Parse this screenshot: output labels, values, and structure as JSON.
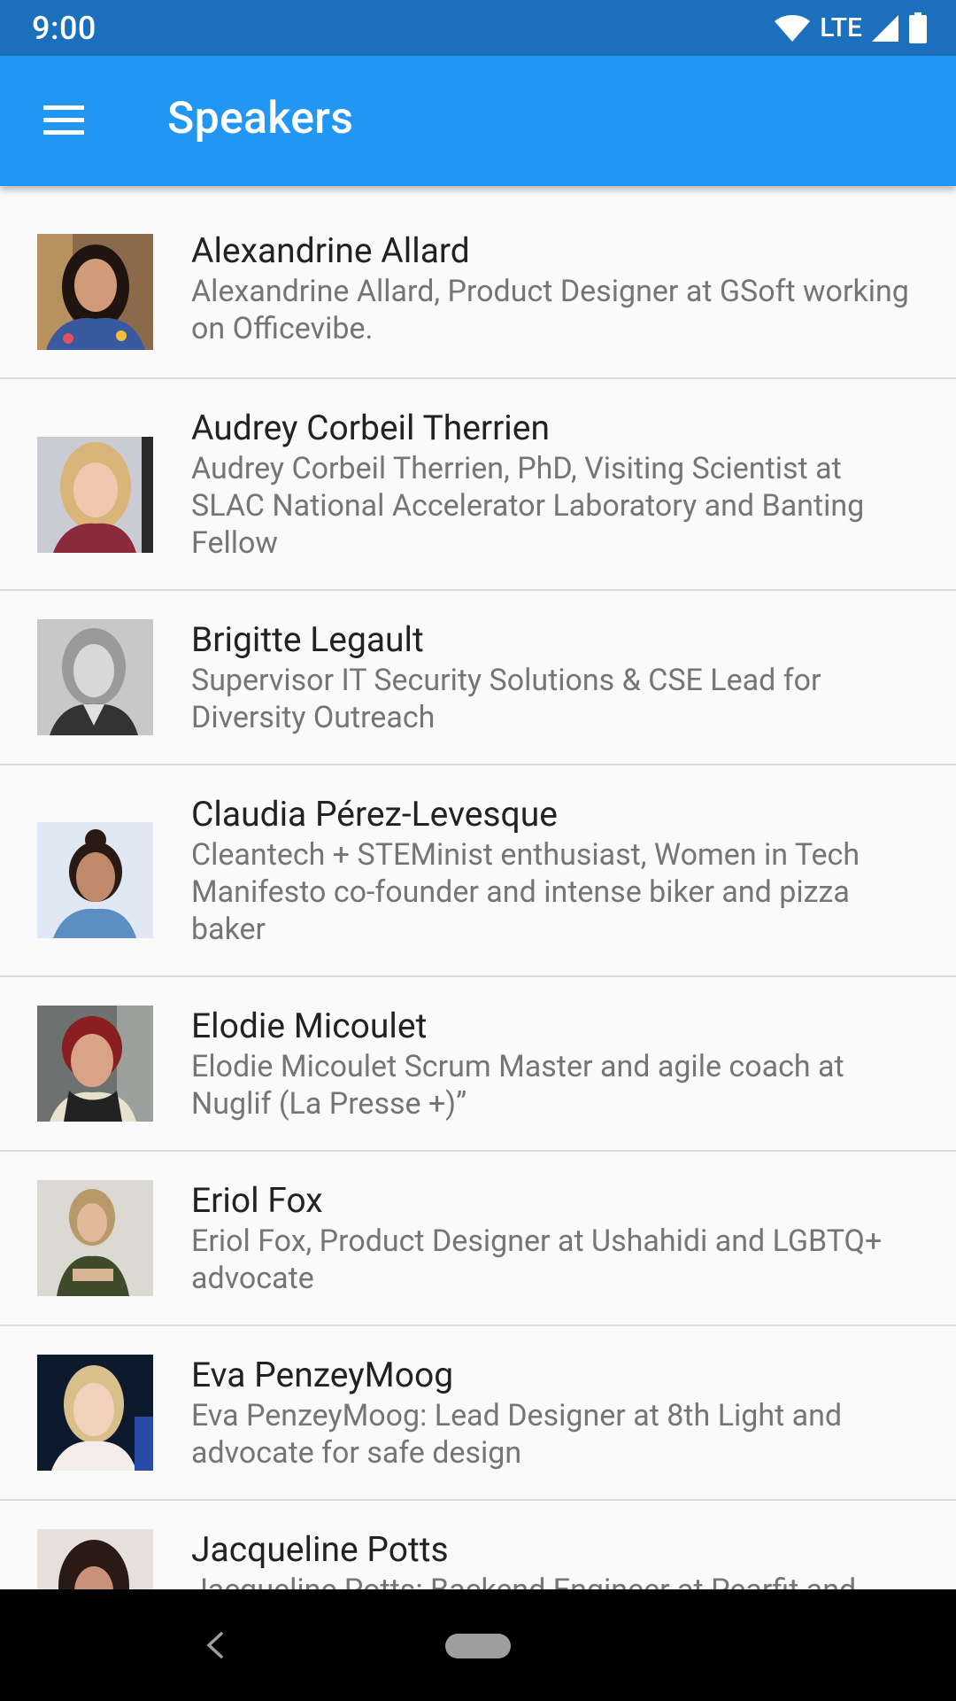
{
  "status_bar": {
    "time": "9:00",
    "network": "LTE"
  },
  "app_bar": {
    "title": "Speakers"
  },
  "speakers": [
    {
      "name": "Alexandrine Allard",
      "description": "Alexandrine Allard, Product Designer at GSoft working on Officevibe."
    },
    {
      "name": "Audrey Corbeil Therrien",
      "description": "Audrey Corbeil Therrien, PhD, Visiting Scientist at SLAC National Accelerator Laboratory and Banting Fellow"
    },
    {
      "name": "Brigitte Legault",
      "description": "Supervisor IT Security Solutions & CSE Lead for Diversity Outreach"
    },
    {
      "name": "Claudia Pérez-Levesque",
      "description": "Cleantech + STEMinist enthusiast, Women in Tech Manifesto co-founder and intense biker and pizza baker"
    },
    {
      "name": "Elodie Micoulet",
      "description": "Elodie Micoulet Scrum Master and agile coach at Nuglif (La Presse +)”"
    },
    {
      "name": "Eriol Fox",
      "description": "Eriol Fox, Product Designer at Ushahidi and LGBTQ+ advocate"
    },
    {
      "name": "Eva PenzeyMoog",
      "description": "Eva PenzeyMoog: Lead Designer at 8th Light and advocate for safe design"
    },
    {
      "name": "Jacqueline Potts",
      "description": "Jacqueline Potts: Backend Engineer at Pearfit and"
    }
  ]
}
